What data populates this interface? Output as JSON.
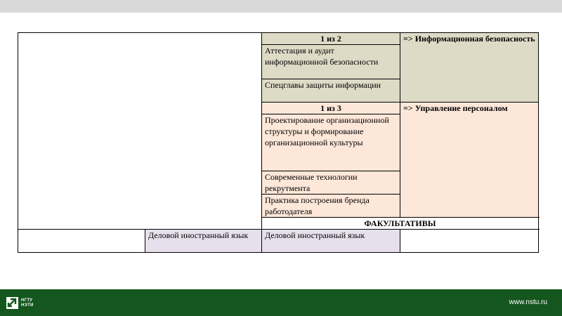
{
  "table": {
    "group1": {
      "header": "1 из 2",
      "items": [
        "Аттестация и аудит информационной безопасности",
        "Спецглавы защиты информации"
      ],
      "arrow": "=>",
      "target": "Информационная безопасность"
    },
    "group2": {
      "header": "1 из 3",
      "items": [
        "Проектирование организационной структуры и формирование организационной культуры",
        "Современные технологии рекрутмента",
        "Практика построения бренда работодателя"
      ],
      "arrow": "=>",
      "target": "Управление персоналом"
    },
    "electives": {
      "title": "ФАКУЛЬТАТИВЫ",
      "col2": "Деловой иностранный язык",
      "col3": "Деловой иностранный язык"
    }
  },
  "footer": {
    "logo_line1": "НГТУ",
    "logo_line2": "НЭТИ",
    "site": "www.nstu.ru"
  },
  "colors": {
    "topbar": "#d9d9d9",
    "footer": "#14561e",
    "tan": "#dddac6",
    "peach": "#fce7d9",
    "lavender": "#e6e0ec"
  }
}
